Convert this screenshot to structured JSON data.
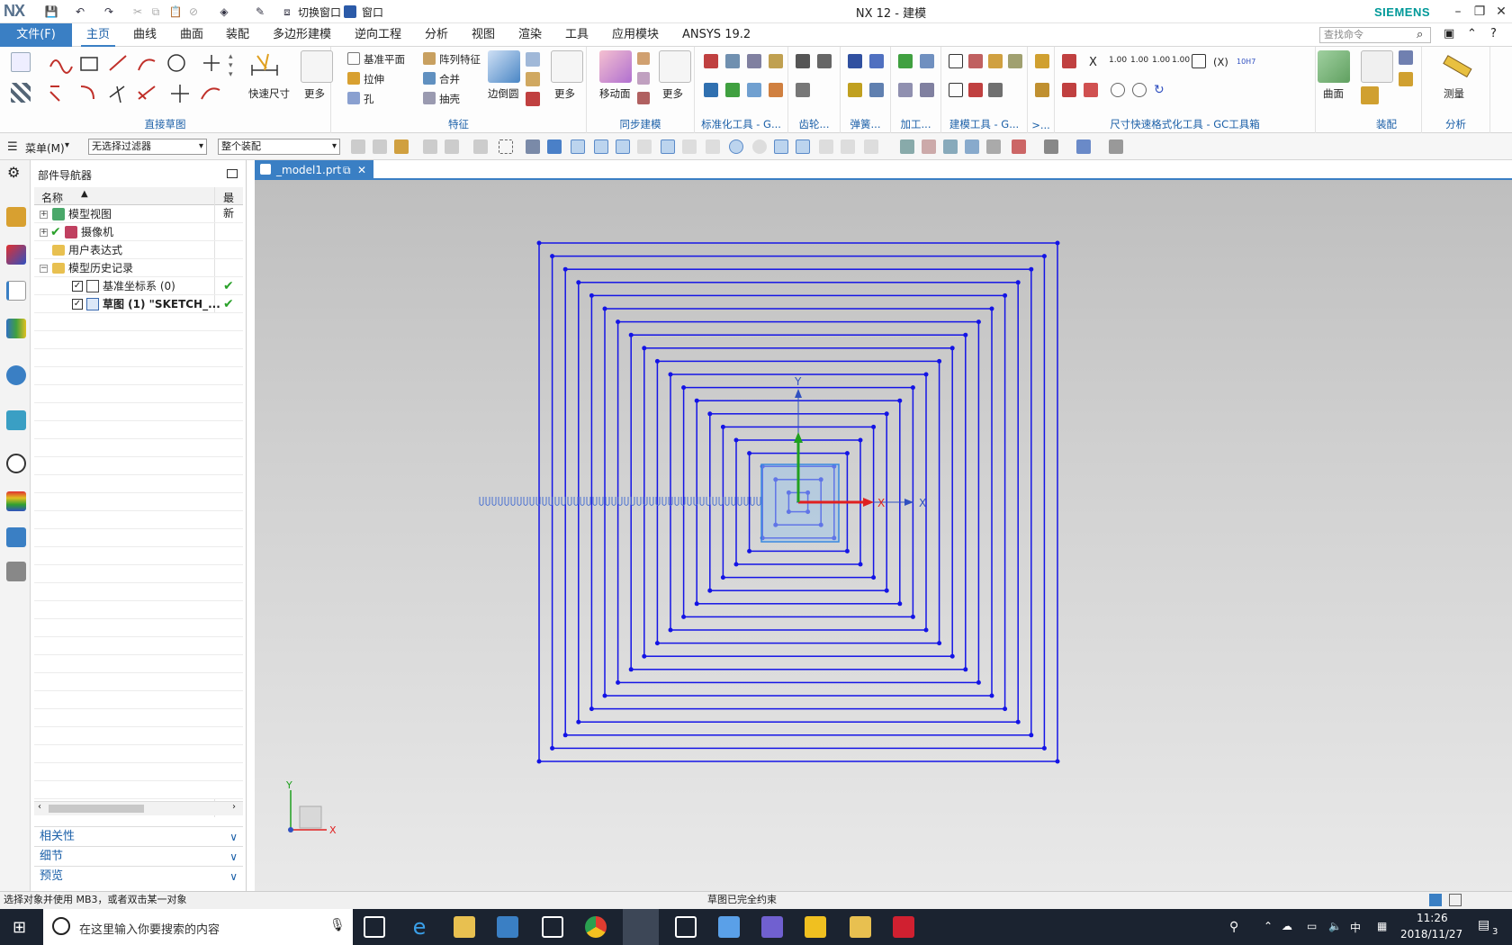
{
  "app": {
    "logo": "NX",
    "title": "NX 12 - 建模",
    "brand": "SIEMENS",
    "quick_access": {
      "switch_window": "切换窗口",
      "window": "窗口"
    }
  },
  "menu": {
    "file": "文件(F)",
    "tabs": [
      "主页",
      "曲线",
      "曲面",
      "装配",
      "多边形建模",
      "逆向工程",
      "分析",
      "视图",
      "渲染",
      "工具",
      "应用模块",
      "ANSYS 19.2"
    ],
    "active_tab": "主页",
    "search_placeholder": "查找命令"
  },
  "ribbon": {
    "groups": {
      "direct_sketch": "直接草图",
      "feature": "特征",
      "sync_modeling": "同步建模",
      "standard_tools": "标准化工具 - G...",
      "gear": "齿轮...",
      "spring": "弹簧...",
      "machining": "加工...",
      "modeling_tools": "建模工具 - G...",
      "more_short": ">...",
      "dim_format": "尺寸快速格式化工具 - GC工具箱",
      "assembly": "装配",
      "analysis": "分析"
    },
    "buttons": {
      "quick_dimension": "快速尺寸",
      "more1": "更多",
      "datum_plane": "基准平面",
      "extrude": "拉伸",
      "hole": "孔",
      "pattern_feature": "阵列特征",
      "unite": "合并",
      "shell": "抽壳",
      "edge_blend": "边倒圆",
      "more2": "更多",
      "move_face": "移动面",
      "more3": "更多",
      "surface": "曲面",
      "measure": "测量"
    },
    "dim_labels": [
      "X",
      "1.00",
      "1.00",
      "1.00",
      "1.00",
      "(X)",
      "10H7"
    ]
  },
  "selection_bar": {
    "menu": "菜单(M)",
    "filter": "无选择过滤器",
    "scope": "整个装配"
  },
  "navigator": {
    "title": "部件导航器",
    "col_name": "名称",
    "col_latest": "最新",
    "rows": [
      {
        "label": "模型视图",
        "level": 0
      },
      {
        "label": "摄像机",
        "level": 0
      },
      {
        "label": "用户表达式",
        "level": 0
      },
      {
        "label": "模型历史记录",
        "level": 0
      },
      {
        "label": "基准坐标系 (0)",
        "level": 1
      },
      {
        "label": "草图 (1) \"SKETCH_...",
        "level": 1
      }
    ],
    "sections": [
      "相关性",
      "细节",
      "预览"
    ]
  },
  "document": {
    "tab": "_model1.prt"
  },
  "graphics": {
    "axis_x": "X",
    "axis_y": "Y",
    "square_count": 21
  },
  "status": {
    "left": "选择对象并使用 MB3，或者双击某一对象",
    "center": "草图已完全约束"
  },
  "taskbar": {
    "search_placeholder": "在这里输入你要搜索的内容",
    "time": "11:26",
    "date": "2018/11/27",
    "ime": "中",
    "notifications": "3"
  },
  "colors": {
    "accent": "#3a7fc4",
    "sketch_line": "#1414e6",
    "axis_x": "#e02020",
    "axis_y": "#20a020",
    "taskbar": "#1b2330"
  }
}
